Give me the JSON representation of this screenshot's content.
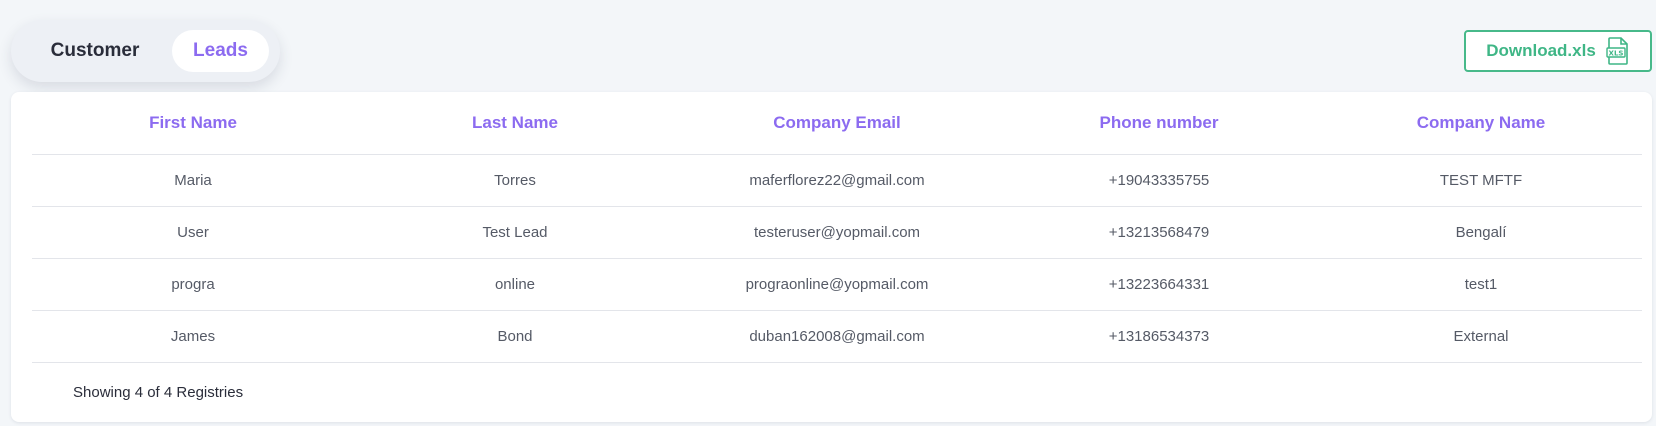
{
  "tabs": {
    "customer_label": "Customer",
    "leads_label": "Leads",
    "active": "Leads"
  },
  "download": {
    "label": "Download.xls",
    "icon": "xls-file-icon",
    "color": "#3fb686"
  },
  "table": {
    "columns": [
      "First Name",
      "Last Name",
      "Company Email",
      "Phone number",
      "Company Name"
    ],
    "rows": [
      [
        "Maria",
        "Torres",
        "maferflorez22@gmail.com",
        "+19043335755",
        "TEST MFTF"
      ],
      [
        "User",
        "Test Lead",
        "testeruser@yopmail.com",
        "+13213568479",
        "Bengalí"
      ],
      [
        "progra",
        "online",
        "prograonline@yopmail.com",
        "+13223664331",
        "test1"
      ],
      [
        "James",
        "Bond",
        "duban162008@gmail.com",
        "+13186534373",
        "External"
      ]
    ]
  },
  "footer": {
    "summary": "Showing 4 of 4 Registries"
  },
  "colors": {
    "accent": "#8c6bf0",
    "download_green": "#3fb686",
    "background": "#f3f6f9"
  }
}
